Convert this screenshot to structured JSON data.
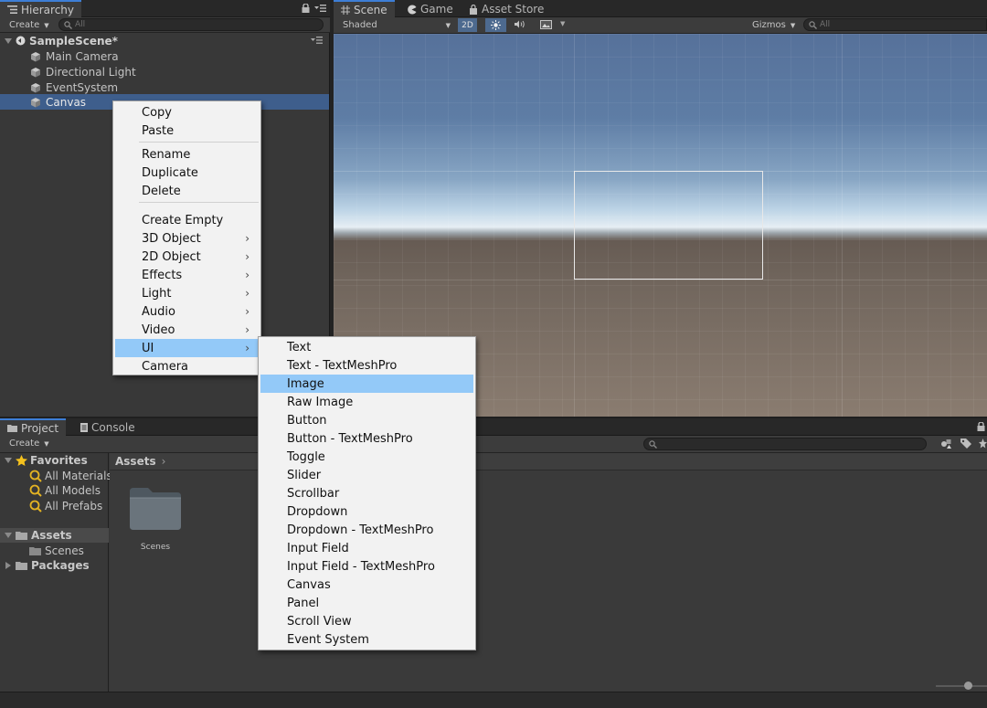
{
  "hierarchy": {
    "tab_label": "Hierarchy",
    "create_label": "Create",
    "search_placeholder": "All",
    "scene_name": "SampleScene*",
    "items": [
      {
        "label": "Main Camera"
      },
      {
        "label": "Directional Light"
      },
      {
        "label": "EventSystem"
      },
      {
        "label": "Canvas",
        "selected": true
      }
    ]
  },
  "scene_view": {
    "tabs": [
      {
        "label": "Scene",
        "icon": "grid-icon",
        "active": true
      },
      {
        "label": "Game",
        "icon": "pacman-icon",
        "active": false
      },
      {
        "label": "Asset Store",
        "icon": "shopping-bag-icon",
        "active": false
      }
    ],
    "shading_mode": "Shaded",
    "mode_2d": "2D",
    "gizmos_label": "Gizmos",
    "search_placeholder": "All"
  },
  "project": {
    "tabs": [
      {
        "label": "Project",
        "icon": "folder-icon",
        "active": true
      },
      {
        "label": "Console",
        "icon": "console-icon",
        "active": false
      }
    ],
    "create_label": "Create",
    "favorites": {
      "label": "Favorites",
      "items": [
        "All Materials",
        "All Models",
        "All Prefabs"
      ]
    },
    "assets_root": "Assets",
    "assets_children": [
      "Scenes"
    ],
    "packages_label": "Packages",
    "breadcrumb": "Assets",
    "folder_items": [
      {
        "label": "Scenes"
      }
    ]
  },
  "context_menu": {
    "groups": [
      [
        "Copy",
        "Paste"
      ],
      [
        "Rename",
        "Duplicate",
        "Delete"
      ],
      [
        "Create Empty",
        "3D Object",
        "2D Object",
        "Effects",
        "Light",
        "Audio",
        "Video",
        "UI",
        "Camera"
      ]
    ],
    "submenu_items": [
      "3D Object",
      "2D Object",
      "Effects",
      "Light",
      "Audio",
      "Video",
      "UI"
    ],
    "highlighted": "UI"
  },
  "ui_submenu": {
    "items": [
      "Text",
      "Text - TextMeshPro",
      "Image",
      "Raw Image",
      "Button",
      "Button - TextMeshPro",
      "Toggle",
      "Slider",
      "Scrollbar",
      "Dropdown",
      "Dropdown - TextMeshPro",
      "Input Field",
      "Input Field - TextMeshPro",
      "Canvas",
      "Panel",
      "Scroll View",
      "Event System"
    ],
    "highlighted": "Image"
  },
  "colors": {
    "selection_blue": "#3e5e8c",
    "menu_highlight": "#93c9f8",
    "tab_accent": "#3d7ed6"
  }
}
